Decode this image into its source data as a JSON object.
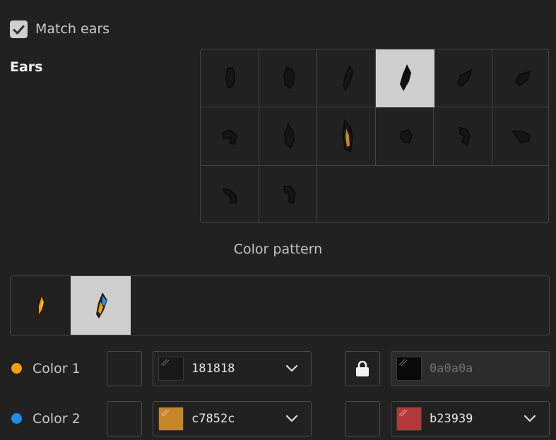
{
  "match_ears": {
    "label": "Match ears",
    "checked": true
  },
  "ears": {
    "title": "Ears",
    "items": [
      {
        "name": "ear-1-icon"
      },
      {
        "name": "ear-2-icon"
      },
      {
        "name": "ear-3-icon"
      },
      {
        "name": "ear-4-icon",
        "selected": true
      },
      {
        "name": "ear-5-icon"
      },
      {
        "name": "ear-6-icon"
      },
      {
        "name": "ear-7-icon"
      },
      {
        "name": "ear-8-icon"
      },
      {
        "name": "ear-9-icon"
      },
      {
        "name": "ear-10-icon"
      },
      {
        "name": "ear-11-icon"
      },
      {
        "name": "ear-12-icon"
      },
      {
        "name": "ear-13-icon"
      },
      {
        "name": "ear-14-icon"
      }
    ]
  },
  "pattern": {
    "title": "Color pattern",
    "items": [
      {
        "name": "pattern-1-icon"
      },
      {
        "name": "pattern-2-icon",
        "selected": true
      }
    ]
  },
  "color1": {
    "label": "Color 1",
    "dot_color": "#f0a10e",
    "primary": {
      "swatch": "#181818",
      "hex": "181818"
    },
    "secondary": {
      "locked": true,
      "lock_icon": "lock-icon",
      "swatch": "#0a0a0a",
      "hex": "0a0a0a"
    }
  },
  "color2": {
    "label": "Color 2",
    "dot_color": "#1e8ee6",
    "primary": {
      "swatch": "#c7852c",
      "hex": "c7852c"
    },
    "secondary": {
      "swatch": "#b23939",
      "hex": "b23939"
    }
  }
}
